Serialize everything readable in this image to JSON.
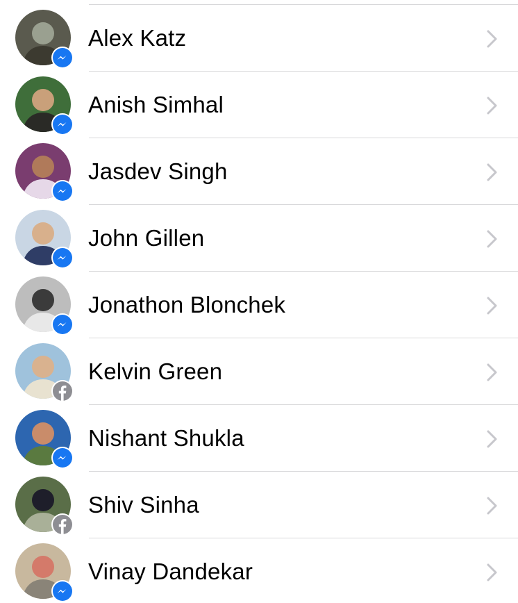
{
  "colors": {
    "messenger_blue": "#1877f2",
    "facebook_gray": "#8e8e93",
    "chevron": "#c7c7cc",
    "divider": "#d8d8da"
  },
  "contacts": [
    {
      "name": "Alex Katz",
      "badge": "messenger-icon",
      "avatar": [
        "#5a5a4e",
        "#9aa090",
        "#3c3a30"
      ]
    },
    {
      "name": "Anish Simhal",
      "badge": "messenger-icon",
      "avatar": [
        "#3f6e3a",
        "#c9a07a",
        "#2a2a26"
      ]
    },
    {
      "name": "Jasdev Singh",
      "badge": "messenger-icon",
      "avatar": [
        "#7a3d6f",
        "#b07a5a",
        "#e6d8e8"
      ]
    },
    {
      "name": "John Gillen",
      "badge": "messenger-icon",
      "avatar": [
        "#c9d6e4",
        "#d8b08c",
        "#2f3d66"
      ]
    },
    {
      "name": "Jonathon Blonchek",
      "badge": "messenger-icon",
      "avatar": [
        "#bdbdbd",
        "#3b3b3b",
        "#e8e8e8"
      ]
    },
    {
      "name": "Kelvin Green",
      "badge": "facebook-icon",
      "avatar": [
        "#9fc2dc",
        "#d9b28f",
        "#e8e2d0"
      ]
    },
    {
      "name": "Nishant Shukla",
      "badge": "messenger-icon",
      "avatar": [
        "#2d66b0",
        "#c98c6a",
        "#5a7a40"
      ]
    },
    {
      "name": "Shiv Sinha",
      "badge": "facebook-icon",
      "avatar": [
        "#5a6e48",
        "#1e1e2a",
        "#a9b098"
      ]
    },
    {
      "name": "Vinay Dandekar",
      "badge": "messenger-icon",
      "avatar": [
        "#c8b89e",
        "#d47a6a",
        "#8a8478"
      ]
    }
  ]
}
